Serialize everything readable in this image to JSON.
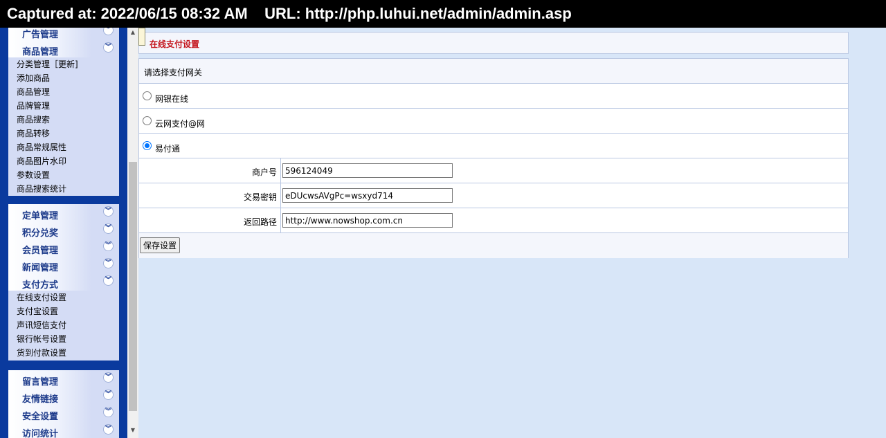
{
  "banner": {
    "text": "Captured at: 2022/06/15 08:32 AM    URL: http://php.luhui.net/admin/admin.asp"
  },
  "sidebar": {
    "group_top_partial": "广告管理",
    "group_goods": {
      "title": "商品管理",
      "items": [
        "分类管理［更新]",
        "添加商品",
        "商品管理",
        "品牌管理",
        "商品搜索",
        "商品转移",
        "商品常规属性",
        "商品图片水印",
        "参数设置",
        "商品搜索统计"
      ]
    },
    "group_mid": [
      "定单管理",
      "积分兑奖",
      "会员管理",
      "新闻管理"
    ],
    "group_pay": {
      "title": "支付方式",
      "items": [
        "在线支付设置",
        "支付宝设置",
        "声讯短信支付",
        "银行帐号设置",
        "货到付款设置"
      ]
    },
    "group_bottom": [
      "留言管理",
      "友情链接",
      "安全设置",
      "访问统计"
    ]
  },
  "page": {
    "title": "在线支付设置",
    "gateway_heading": "请选择支付网关",
    "gateways": [
      {
        "label": "网银在线",
        "checked": false
      },
      {
        "label": "云网支付@网",
        "checked": false
      },
      {
        "label": "易付通",
        "checked": true
      }
    ],
    "fields": [
      {
        "label": "商户号",
        "value": "596124049"
      },
      {
        "label": "交易密钥",
        "value": "eDUcwsAVgPc=wsxyd714"
      },
      {
        "label": "返回路径",
        "value": "http://www.nowshop.com.cn"
      }
    ],
    "save_label": "保存设置"
  },
  "icons": {
    "chevron": "double-chevron-down-icon",
    "scroll_up": "arrow-up-icon",
    "scroll_down": "arrow-down-icon"
  }
}
